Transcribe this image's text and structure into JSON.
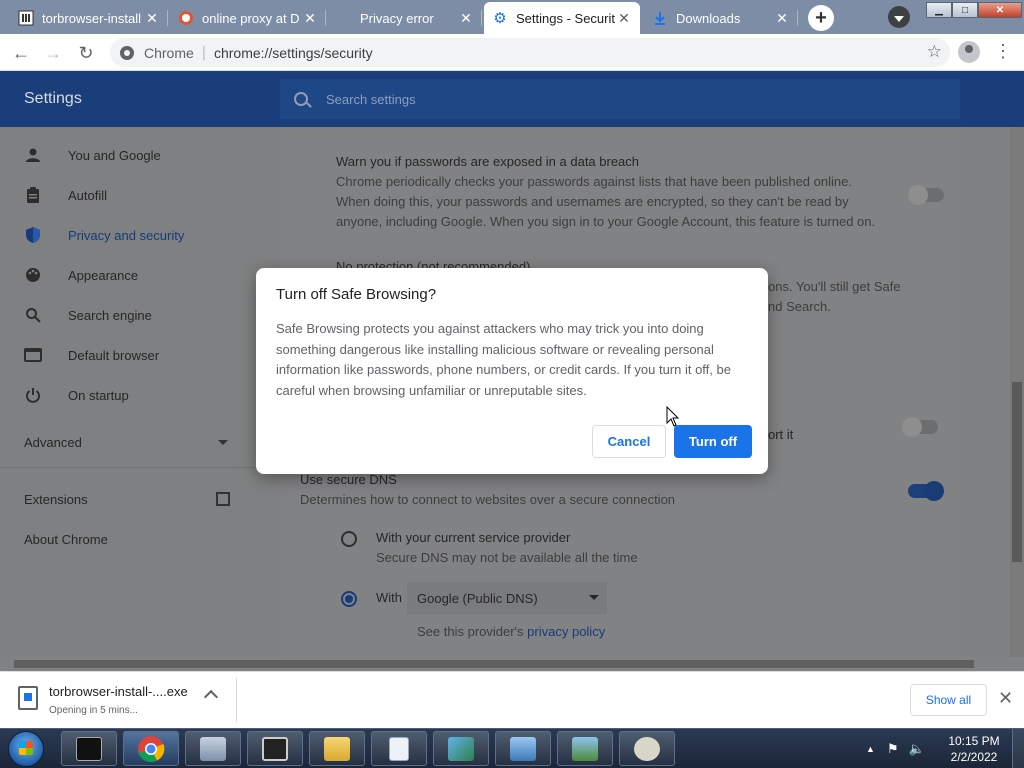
{
  "tabs": [
    {
      "title": "torbrowser-install",
      "favicon": "page-icon"
    },
    {
      "title": "online proxy at D",
      "favicon": "duckduckgo-icon"
    },
    {
      "title": "Privacy error",
      "favicon": "none"
    },
    {
      "title": "Settings - Securit",
      "favicon": "gear-icon"
    },
    {
      "title": "Downloads",
      "favicon": "download-icon"
    }
  ],
  "toolbar": {
    "site_label": "Chrome",
    "url": "chrome://settings/security"
  },
  "settings": {
    "title": "Settings",
    "search_placeholder": "Search settings"
  },
  "sidebar": {
    "items": [
      {
        "label": "You and Google",
        "icon": "person-icon"
      },
      {
        "label": "Autofill",
        "icon": "clipboard-icon"
      },
      {
        "label": "Privacy and security",
        "icon": "shield-icon"
      },
      {
        "label": "Appearance",
        "icon": "palette-icon"
      },
      {
        "label": "Search engine",
        "icon": "search-icon"
      },
      {
        "label": "Default browser",
        "icon": "browser-icon"
      },
      {
        "label": "On startup",
        "icon": "power-icon"
      }
    ],
    "advanced": "Advanced",
    "extensions": "Extensions",
    "about": "About Chrome"
  },
  "content": {
    "breach_title": "Warn you if passwords are exposed in a data breach",
    "breach_line1": "Chrome periodically checks your passwords against lists that have been published online.",
    "breach_line2": "When doing this, your passwords and usernames are encrypted, so they can't be read by",
    "breach_line3": "anyone, including Google. When you sign in to your Google Account, this feature is turned on.",
    "no_protection": "No protection (not recommended)",
    "partial_right1": "ons. You'll still get Safe",
    "partial_right2": "nd Search.",
    "partial_right3": "ort it",
    "dns_title": "Use secure DNS",
    "dns_desc": "Determines how to connect to websites over a secure connection",
    "dns_opt1": "With your current service provider",
    "dns_opt1_sub": "Secure DNS may not be available all the time",
    "dns_opt2": "With",
    "dns_provider": "Google (Public DNS)",
    "see_provider": "See this provider's",
    "privacy_policy": "privacy policy"
  },
  "dialog": {
    "title": "Turn off Safe Browsing?",
    "body": "Safe Browsing protects you against attackers who may trick you into doing something dangerous like installing malicious software or revealing personal information like passwords, phone numbers, or credit cards. If you turn it off, be careful when browsing unfamiliar or unreputable sites.",
    "cancel": "Cancel",
    "confirm": "Turn off"
  },
  "download": {
    "filename": "torbrowser-install-....exe",
    "status": "Opening in 5 mins...",
    "show_all": "Show all"
  },
  "taskbar": {
    "apps": [
      "cmd-icon",
      "chrome-icon",
      "network-icon",
      "terminal-icon",
      "folder-icon",
      "document-icon",
      "cube-icon",
      "control-panel-icon",
      "image-viewer-icon",
      "troll-face-icon"
    ],
    "time": "10:15 PM",
    "date": "2/2/2022"
  },
  "colors": {
    "accent": "#1a73e8",
    "tabstrip": "#7d8da6",
    "header_dimmed": "#1a3e7a"
  }
}
